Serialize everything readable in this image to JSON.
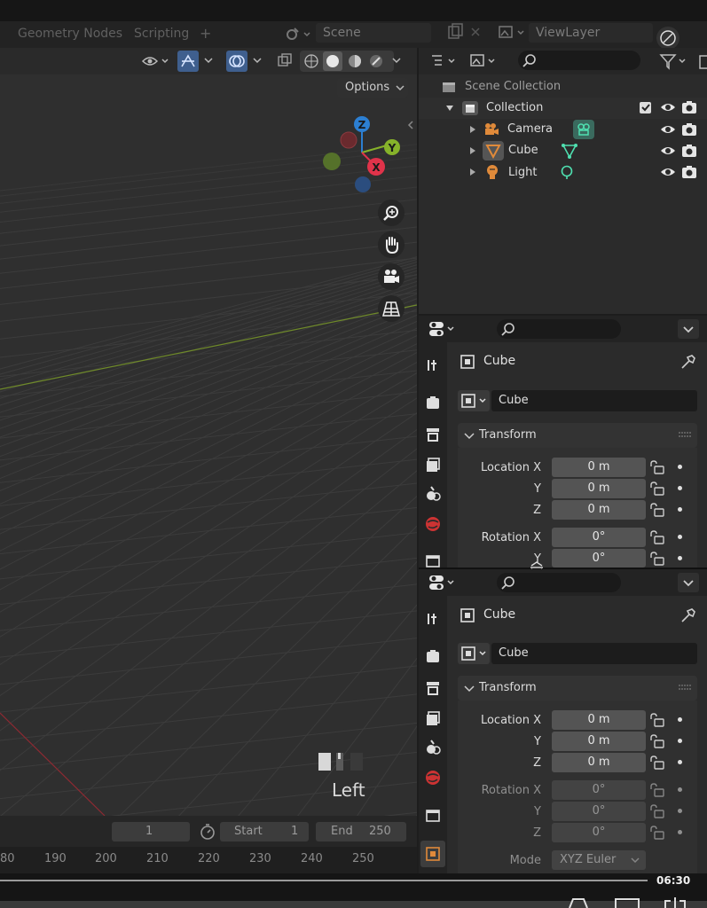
{
  "workspace_tabs": {
    "geometry_nodes": "Geometry Nodes",
    "scripting": "Scripting",
    "add": "+"
  },
  "scene": {
    "label": "Scene"
  },
  "view_layer": {
    "label": "ViewLayer"
  },
  "viewport": {
    "options_label": "Options",
    "view_name": "Left"
  },
  "gizmo": {
    "z": "Z",
    "y": "Y",
    "x": "X"
  },
  "outliner": {
    "scene_collection": "Scene Collection",
    "collection": "Collection",
    "items": [
      {
        "label": "Camera",
        "icon": "camera-icon"
      },
      {
        "label": "Cube",
        "icon": "mesh-icon"
      },
      {
        "label": "Light",
        "icon": "light-icon"
      }
    ]
  },
  "properties": {
    "object_name": "Cube",
    "name_field": "Cube",
    "panel_title": "Transform",
    "location_label": "Location X",
    "rotation_label": "Rotation X",
    "y_label": "Y",
    "z_label": "Z",
    "location": {
      "x": "0 m",
      "y": "0 m",
      "z": "0 m"
    },
    "rotation": {
      "x": "0°",
      "y": "0°",
      "z": "0°"
    },
    "mode_label": "Mode",
    "mode_value": "XYZ Euler"
  },
  "timeline": {
    "current_frame": "1",
    "start_label": "Start",
    "start_value": "1",
    "end_label": "End",
    "end_value": "250",
    "ruler": [
      "80",
      "190",
      "200",
      "210",
      "220",
      "230",
      "240",
      "250"
    ]
  },
  "video": {
    "time": "06:30"
  },
  "colors": {
    "x_axis": "#e0334a",
    "y_axis": "#86b22a",
    "z_axis": "#2c7fd2",
    "accent": "#4a77c9"
  }
}
